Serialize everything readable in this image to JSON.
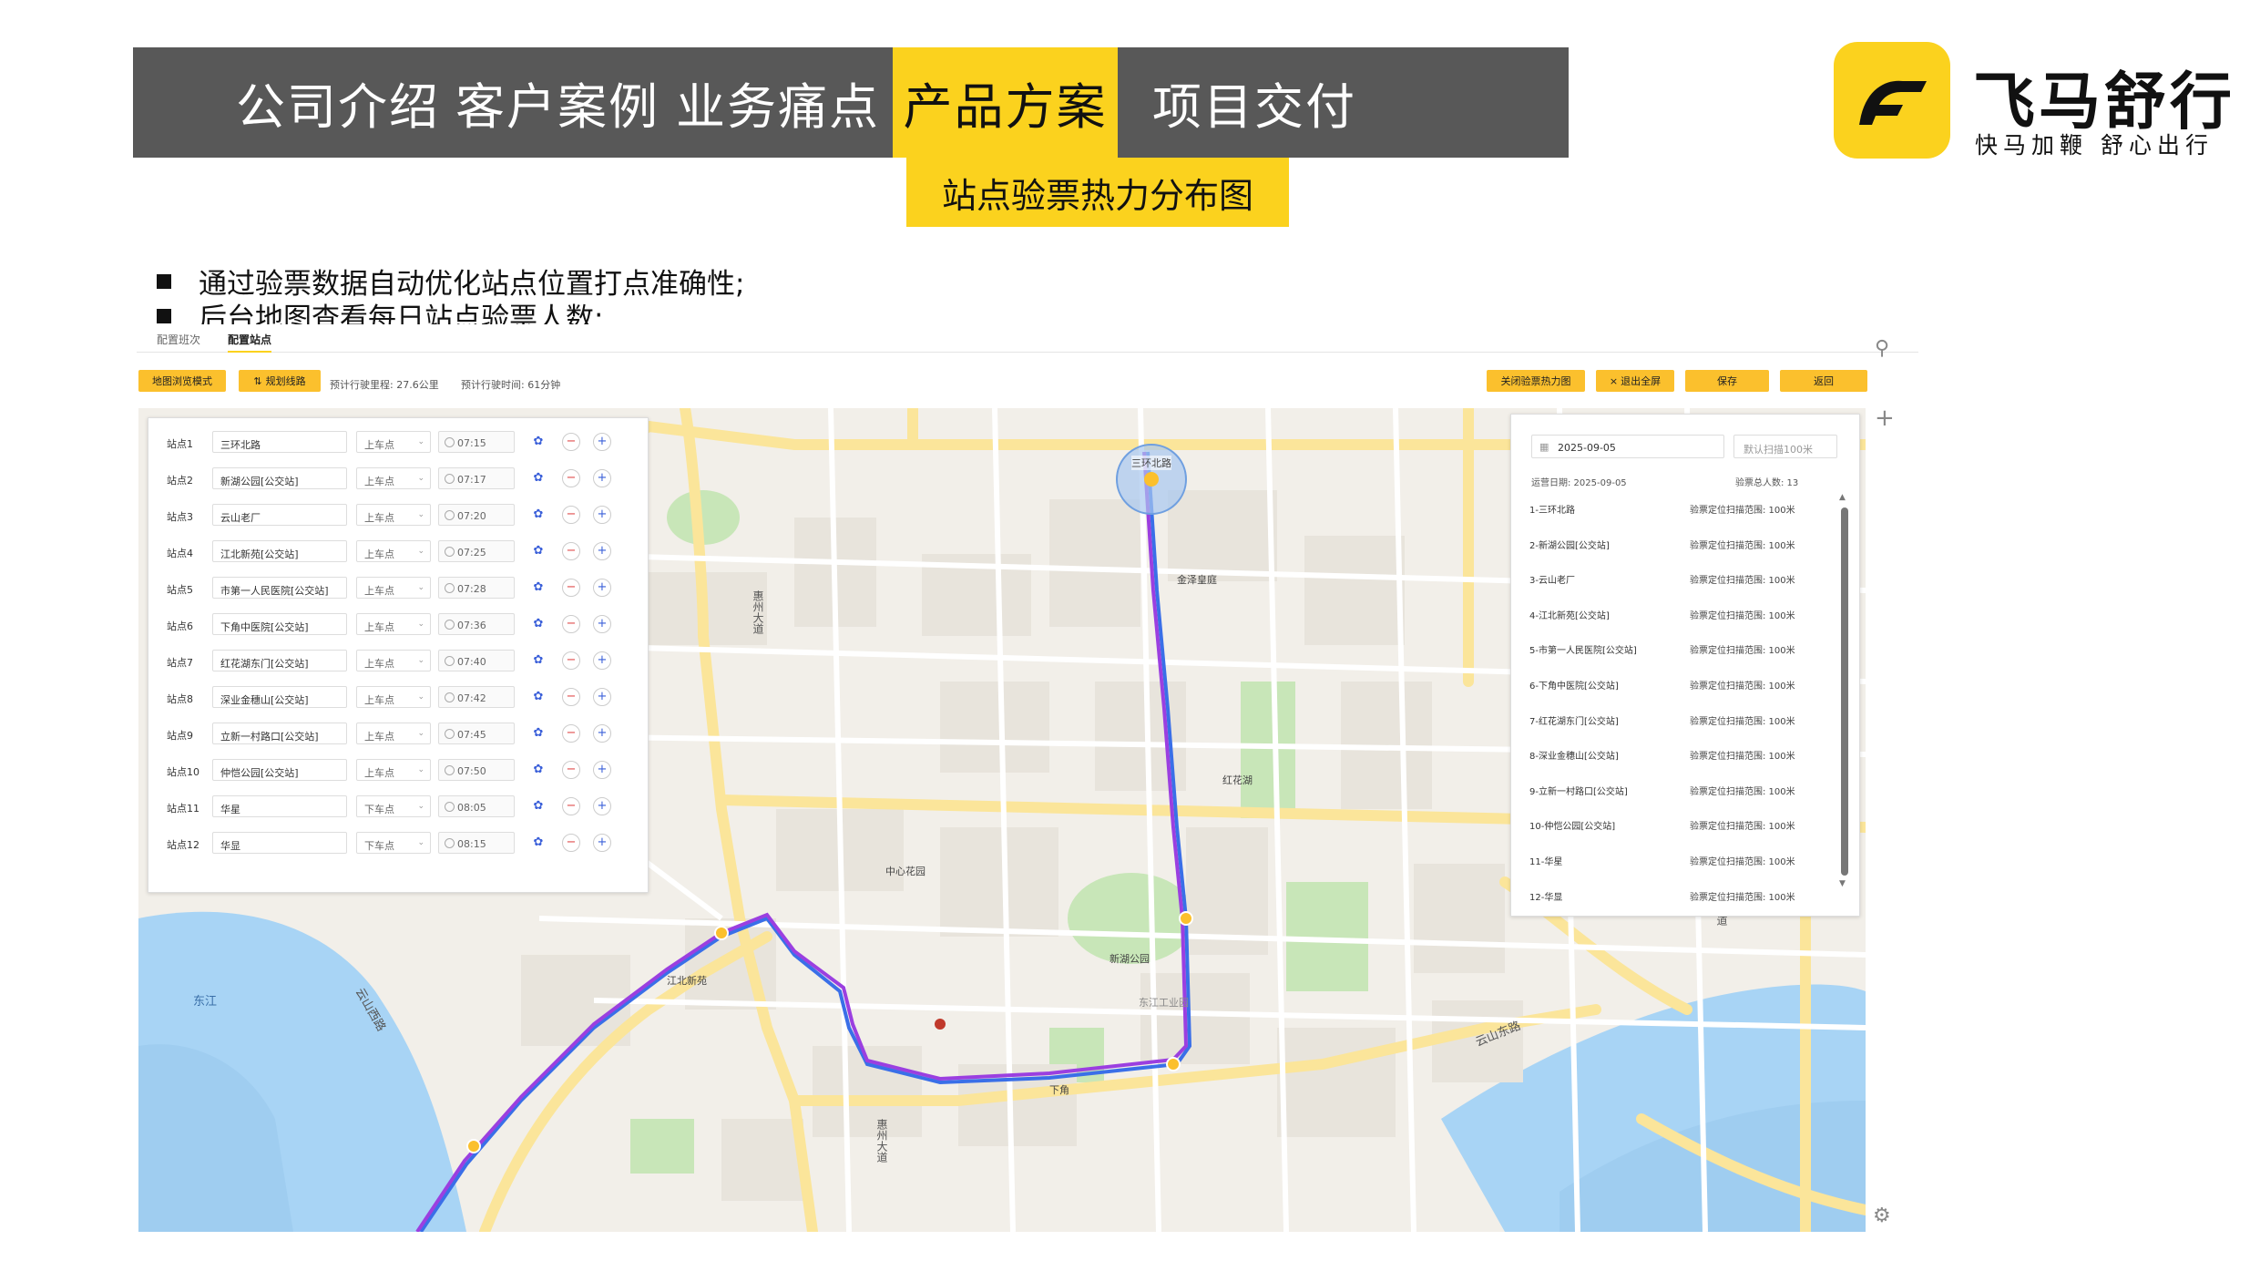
{
  "nav": {
    "tabs": [
      "公司介绍",
      "客户案例",
      "业务痛点",
      "产品方案",
      "项目交付"
    ],
    "active_index": 3,
    "subtab": "站点验票热力分布图"
  },
  "logo": {
    "name": "飞马舒行",
    "slogan": "快马加鞭  舒心出行"
  },
  "bullets": [
    "通过验票数据自动优化站点位置打点准确性;",
    "后台地图查看每日站点验票人数;"
  ],
  "app": {
    "tabs": [
      "配置班次",
      "配置站点"
    ],
    "active_tab": 1,
    "toolbar": {
      "browse_mode": "地图浏览模式",
      "plan_route": "规划线路",
      "est_distance": "预计行驶里程: 27.6公里",
      "est_time": "预计行驶时间: 61分钟",
      "close_heatmap": "关闭验票热力图",
      "exit_fullscreen": "退出全屏",
      "save": "保存",
      "back": "返回"
    },
    "stops": [
      {
        "label": "站点1",
        "name": "三环北路",
        "type": "上车点",
        "time": "07:15"
      },
      {
        "label": "站点2",
        "name": "新湖公园[公交站]",
        "type": "上车点",
        "time": "07:17"
      },
      {
        "label": "站点3",
        "name": "云山老厂",
        "type": "上车点",
        "time": "07:20"
      },
      {
        "label": "站点4",
        "name": "江北新苑[公交站]",
        "type": "上车点",
        "time": "07:25"
      },
      {
        "label": "站点5",
        "name": "市第一人民医院[公交站]",
        "type": "上车点",
        "time": "07:28"
      },
      {
        "label": "站点6",
        "name": "下角中医院[公交站]",
        "type": "上车点",
        "time": "07:36"
      },
      {
        "label": "站点7",
        "name": "红花湖东门[公交站]",
        "type": "上车点",
        "time": "07:40"
      },
      {
        "label": "站点8",
        "name": "深业金穗山[公交站]",
        "type": "上车点",
        "time": "07:42"
      },
      {
        "label": "站点9",
        "name": "立新一村路口[公交站]",
        "type": "上车点",
        "time": "07:45"
      },
      {
        "label": "站点10",
        "name": "仲恺公园[公交站]",
        "type": "上车点",
        "time": "07:50"
      },
      {
        "label": "站点11",
        "name": "华星",
        "type": "下车点",
        "time": "08:05"
      },
      {
        "label": "站点12",
        "name": "华显",
        "type": "下车点",
        "time": "08:15"
      }
    ],
    "right_panel": {
      "date": "2025-09-05",
      "range_placeholder": "默认扫描100米",
      "run_date": "运营日期: 2025-09-05",
      "total": "验票总人数: 13",
      "items": [
        {
          "name": "1-三环北路",
          "range": "验票定位扫描范围: 100米"
        },
        {
          "name": "2-新湖公园[公交站]",
          "range": "验票定位扫描范围: 100米"
        },
        {
          "name": "3-云山老厂",
          "range": "验票定位扫描范围: 100米"
        },
        {
          "name": "4-江北新苑[公交站]",
          "range": "验票定位扫描范围: 100米"
        },
        {
          "name": "5-市第一人民医院[公交站]",
          "range": "验票定位扫描范围: 100米"
        },
        {
          "name": "6-下角中医院[公交站]",
          "range": "验票定位扫描范围: 100米"
        },
        {
          "name": "7-红花湖东门[公交站]",
          "range": "验票定位扫描范围: 100米"
        },
        {
          "name": "8-深业金穗山[公交站]",
          "range": "验票定位扫描范围: 100米"
        },
        {
          "name": "9-立新一村路口[公交站]",
          "range": "验票定位扫描范围: 100米"
        },
        {
          "name": "10-仲恺公园[公交站]",
          "range": "验票定位扫描范围: 100米"
        },
        {
          "name": "11-华星",
          "range": "验票定位扫描范围: 100米"
        },
        {
          "name": "12-华显",
          "range": "验票定位扫描范围: 100米"
        }
      ]
    },
    "map_labels": [
      "三环北路",
      "惠州大道",
      "新湖公园",
      "东江工业园",
      "云山西路",
      "云山东路",
      "东江",
      "江北新苑",
      "下角",
      "金泽皇庭",
      "红花湖",
      "水口大道",
      "惠州大道",
      "中心花园"
    ]
  },
  "colors": {
    "accent": "#fbd21e",
    "nav_bg": "#585858",
    "route": "#9b3fe0",
    "route_alt": "#3a6fe8",
    "water": "#a8d4f5",
    "green": "#c8e6b8"
  }
}
